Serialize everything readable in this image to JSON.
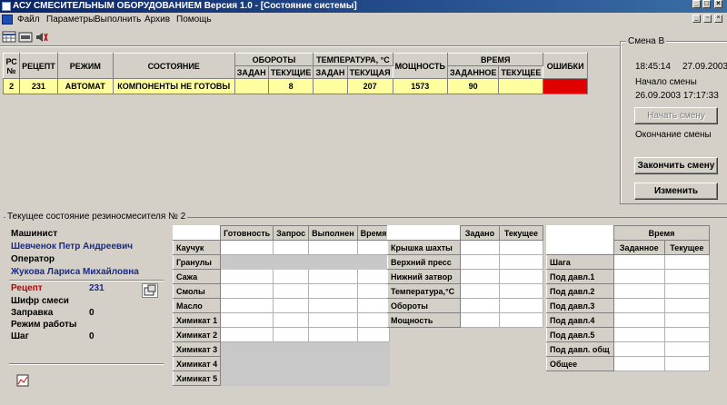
{
  "window": {
    "title": "АСУ СМЕСИТЕЛЬНЫМ ОБОРУДОВАНИЕМ  Версия 1.0 - [Состояние системы]"
  },
  "menu": [
    "Файл",
    "Параметры",
    "Выполнить",
    "Архив",
    "Помощь"
  ],
  "toolbar": {
    "icons": [
      "table-icon",
      "panel-icon",
      "speaker-icon"
    ]
  },
  "main_table": {
    "headers": {
      "rs": "РС №",
      "recipe": "РЕЦЕПТ",
      "mode": "РЕЖИМ",
      "state": "СОСТОЯНИЕ",
      "rpm": "ОБОРОТЫ",
      "temp": "ТЕМПЕРАТУРА, °С",
      "power": "МОЩНОСТЬ",
      "time": "ВРЕМЯ",
      "errors": "ОШИБКИ",
      "set": "ЗАДАН",
      "current": "ТЕКУЩИЕ",
      "set2": "ЗАДАН",
      "current2": "ТЕКУЩАЯ",
      "time_set": "ЗАДАННОЕ",
      "time_current": "ТЕКУЩЕЕ"
    },
    "row": {
      "rs": "2",
      "recipe": "231",
      "mode": "АВТОМАТ",
      "state": "КОМПОНЕНТЫ НЕ ГОТОВЫ",
      "rpm_set": "",
      "rpm_current": "8",
      "temp_set": "",
      "temp_current": "207",
      "power": "1573",
      "time_set": "90",
      "time_current": "",
      "error_color": "#e00000"
    }
  },
  "shift": {
    "legend": "Смена В",
    "time": "18:45:14",
    "date": "27.09.2003",
    "start_label": "Начало смены",
    "start_value": "26.09.2003 17:17:33",
    "start_button": "Начать смену",
    "end_label": "Окончание смены",
    "end_button": "Закончить смену",
    "change_button": "Изменить"
  },
  "mixer": {
    "legend": "Текущее состояние резиносмесителя № 2",
    "operator1_label": "Машинист",
    "operator1_name": "Шевченок Петр Андреевич",
    "operator2_label": "Оператор",
    "operator2_name": "Жукова Лариса Михайловна",
    "recipe_label": "Рецепт",
    "recipe_value": "231",
    "cipher_label": "Шифр смеси",
    "fill_label": "Заправка",
    "fill_value": "0",
    "mode_label": "Режим работы",
    "step_label": "Шаг",
    "step_value": "0"
  },
  "components": {
    "headers": [
      "Готовность",
      "Запрос",
      "Выполнен",
      "Время"
    ],
    "rows": [
      "Каучук",
      "Гранулы",
      "Сажа",
      "Смолы",
      "Масло",
      "Химикат 1",
      "Химикат 2",
      "Химикат 3",
      "Химикат 4",
      "Химикат 5"
    ]
  },
  "params": {
    "headers": [
      "Задано",
      "Текущее"
    ],
    "rows": [
      "Крышка шахты",
      "Верхний пресс",
      "Нижний затвор",
      "Температура,°С",
      "Обороты",
      "Мощность"
    ]
  },
  "steps": {
    "group": "Время",
    "headers": [
      "Заданное",
      "Текущее"
    ],
    "rows": [
      "Шага",
      "Под давл.1",
      "Под давл.2",
      "Под давл.3",
      "Под давл.4",
      "Под давл.5",
      "Под давл. общ",
      "Общее"
    ]
  }
}
